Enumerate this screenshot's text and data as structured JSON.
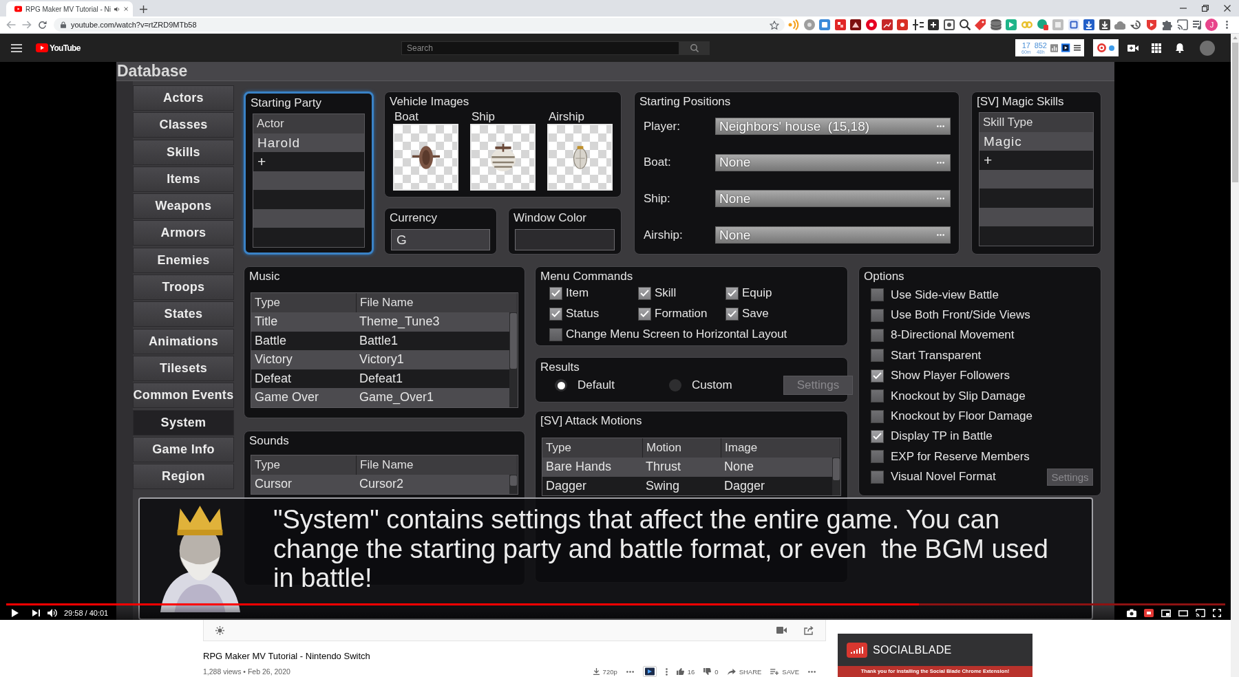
{
  "browser": {
    "tab": {
      "title": "RPG Maker MV Tutorial - Ni",
      "audio_playing": true
    },
    "address": "youtube.com/watch?v=rtZRD9MTb58",
    "profile_initial": "J"
  },
  "youtube_header": {
    "logo": "YouTube",
    "search": {
      "placeholder": "Search"
    },
    "stats": [
      {
        "value": "17",
        "period": "60m"
      },
      {
        "value": "852",
        "period": "48h"
      }
    ]
  },
  "database": {
    "title": "Database",
    "sidebar": [
      {
        "label": "Actors",
        "selected": false
      },
      {
        "label": "Classes",
        "selected": false
      },
      {
        "label": "Skills",
        "selected": false
      },
      {
        "label": "Items",
        "selected": false
      },
      {
        "label": "Weapons",
        "selected": false
      },
      {
        "label": "Armors",
        "selected": false
      },
      {
        "label": "Enemies",
        "selected": false
      },
      {
        "label": "Troops",
        "selected": false
      },
      {
        "label": "States",
        "selected": false
      },
      {
        "label": "Animations",
        "selected": false
      },
      {
        "label": "Tilesets",
        "selected": false
      },
      {
        "label": "Common Events",
        "selected": false
      },
      {
        "label": "System",
        "selected": true
      },
      {
        "label": "Game Info",
        "selected": false
      },
      {
        "label": "Region",
        "selected": false
      }
    ],
    "starting_party": {
      "title": "Starting Party",
      "selected": true,
      "header": "Actor",
      "rows": [
        "Harold"
      ],
      "add_label": "+"
    },
    "vehicle_images": {
      "title": "Vehicle Images",
      "vehicles": [
        {
          "label": "Boat",
          "kind": "boat"
        },
        {
          "label": "Ship",
          "kind": "ship"
        },
        {
          "label": "Airship",
          "kind": "airship"
        }
      ]
    },
    "currency": {
      "title": "Currency",
      "value": "G"
    },
    "window_color": {
      "title": "Window Color"
    },
    "starting_positions": {
      "title": "Starting Positions",
      "rows": [
        {
          "label": "Player:",
          "value": "Neighbors' house  (15,18)"
        },
        {
          "label": "Boat:",
          "value": "None"
        },
        {
          "label": "Ship:",
          "value": "None"
        },
        {
          "label": "Airship:",
          "value": "None"
        }
      ]
    },
    "magic_skills": {
      "title": "[SV] Magic Skills",
      "selected": false,
      "header": "Skill Type",
      "rows": [
        "Magic"
      ],
      "add_label": "+"
    },
    "music": {
      "title": "Music",
      "columns": [
        "Type",
        "File Name"
      ],
      "rows": [
        [
          "Title",
          "Theme_Tune3"
        ],
        [
          "Battle",
          "Battle1"
        ],
        [
          "Victory",
          "Victory1"
        ],
        [
          "Defeat",
          "Defeat1"
        ],
        [
          "Game Over",
          "Game_Over1"
        ]
      ]
    },
    "sounds": {
      "title": "Sounds",
      "columns": [
        "Type",
        "File Name"
      ],
      "rows": [
        [
          "Cursor",
          "Cursor2"
        ]
      ]
    },
    "menu_commands": {
      "title": "Menu Commands",
      "items": [
        {
          "label": "Item",
          "checked": true
        },
        {
          "label": "Skill",
          "checked": true
        },
        {
          "label": "Equip",
          "checked": true
        },
        {
          "label": "Status",
          "checked": true
        },
        {
          "label": "Formation",
          "checked": true
        },
        {
          "label": "Save",
          "checked": true
        },
        {
          "label": "Change Menu Screen to Horizontal Layout",
          "checked": false
        }
      ]
    },
    "results": {
      "title": "Results",
      "options": [
        {
          "label": "Default",
          "selected": true
        },
        {
          "label": "Custom",
          "selected": false
        }
      ],
      "settings_button": {
        "label": "Settings",
        "disabled": true
      }
    },
    "attack_motions": {
      "title": "[SV] Attack Motions",
      "columns": [
        "Type",
        "Motion",
        "Image"
      ],
      "rows": [
        [
          "Bare Hands",
          "Thrust",
          "None"
        ],
        [
          "Dagger",
          "Swing",
          "Dagger"
        ]
      ]
    },
    "options": {
      "title": "Options",
      "items": [
        {
          "label": "Use Side-view Battle",
          "checked": false
        },
        {
          "label": "Use Both Front/Side Views",
          "checked": false
        },
        {
          "label": "8-Directional Movement",
          "checked": false
        },
        {
          "label": "Start Transparent",
          "checked": false
        },
        {
          "label": "Show Player Followers",
          "checked": true
        },
        {
          "label": "Knockout by Slip Damage",
          "checked": false
        },
        {
          "label": "Knockout by Floor Damage",
          "checked": false
        },
        {
          "label": "Display TP in Battle",
          "checked": true
        },
        {
          "label": "EXP for Reserve Members",
          "checked": false
        },
        {
          "label": "Visual Novel Format",
          "checked": false
        }
      ],
      "settings_button": {
        "label": "Settings",
        "disabled": true
      }
    }
  },
  "subtitle": {
    "text": "\"System\" contains settings that affect the entire game. You can change the starting party and battle format, or even  the BGM used in battle!"
  },
  "player": {
    "level": 0.749,
    "time": "29:58 / 40:01"
  },
  "video_info": {
    "title": "RPG Maker MV Tutorial - Nintendo Switch",
    "meta": "1,288 views • Feb 26, 2020",
    "quality": "720p",
    "likes": "16",
    "dislikes": "0",
    "share": "SHARE",
    "save": "SAVE"
  },
  "ad": {
    "brand": "SOCIALBLADE",
    "message": "Thank you for installing the Social Blade Chrome Extension!"
  }
}
